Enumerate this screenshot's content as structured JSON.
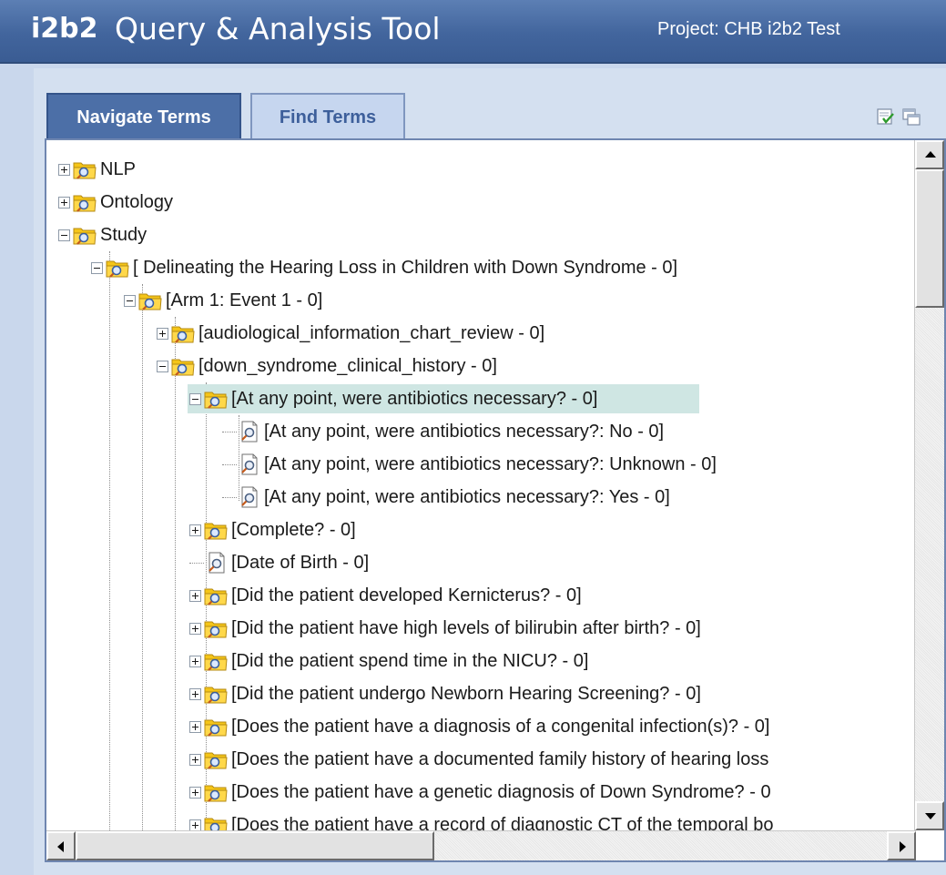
{
  "header": {
    "logo": "i2b2",
    "title": "Query & Analysis Tool",
    "project": "Project: CHB i2b2 Test"
  },
  "tabs": [
    {
      "label": "Navigate Terms",
      "active": true
    },
    {
      "label": "Find Terms",
      "active": false
    }
  ],
  "toolbar": {
    "icons": [
      "checklist-icon",
      "windows-icon"
    ]
  },
  "tree": {
    "rows": [
      {
        "label": "NLP",
        "type": "folder",
        "state": "collapsed"
      },
      {
        "label": "Ontology",
        "type": "folder",
        "state": "collapsed"
      },
      {
        "label": "Study",
        "type": "folder",
        "state": "expanded"
      },
      {
        "label": "[ Delineating the Hearing Loss in Children with Down Syndrome - 0]",
        "type": "folder",
        "state": "expanded"
      },
      {
        "label": "[Arm 1: Event 1 - 0]",
        "type": "folder",
        "state": "expanded"
      },
      {
        "label": "[audiological_information_chart_review - 0]",
        "type": "folder",
        "state": "collapsed"
      },
      {
        "label": "[down_syndrome_clinical_history - 0]",
        "type": "folder",
        "state": "expanded"
      },
      {
        "label": "[At any point, were antibiotics necessary? - 0]",
        "type": "folder",
        "state": "expanded",
        "selected": true
      },
      {
        "label": "[At any point, were antibiotics necessary?: No - 0]",
        "type": "leaf"
      },
      {
        "label": "[At any point, were antibiotics necessary?: Unknown - 0]",
        "type": "leaf"
      },
      {
        "label": "[At any point, were antibiotics necessary?: Yes - 0]",
        "type": "leaf"
      },
      {
        "label": "[Complete? - 0]",
        "type": "folder",
        "state": "collapsed"
      },
      {
        "label": "[Date of Birth - 0]",
        "type": "leaf"
      },
      {
        "label": "[Did the patient developed Kernicterus? - 0]",
        "type": "folder",
        "state": "collapsed"
      },
      {
        "label": "[Did the patient have high levels of bilirubin after birth? - 0]",
        "type": "folder",
        "state": "collapsed"
      },
      {
        "label": "[Did the patient spend time in the NICU? - 0]",
        "type": "folder",
        "state": "collapsed"
      },
      {
        "label": "[Did the patient undergo Newborn Hearing Screening? - 0]",
        "type": "folder",
        "state": "collapsed"
      },
      {
        "label": "[Does the patient have a diagnosis of a congenital infection(s)? - 0]",
        "type": "folder",
        "state": "collapsed"
      },
      {
        "label": "[Does the patient have a documented family history of hearing loss",
        "type": "folder",
        "state": "collapsed"
      },
      {
        "label": "[Does the patient have a genetic diagnosis of Down Syndrome? - 0",
        "type": "folder",
        "state": "collapsed"
      },
      {
        "label": "[Does the patient have a record of diagnostic CT of the temporal bo",
        "type": "folder",
        "state": "collapsed"
      }
    ]
  },
  "colors": {
    "header_bg": "#42659d",
    "tab_active_bg": "#4c6fa7",
    "tab_inactive_bg": "#c6d6ef",
    "selection_bg": "#cfe6e3",
    "folder_yellow": "#f5c518"
  }
}
